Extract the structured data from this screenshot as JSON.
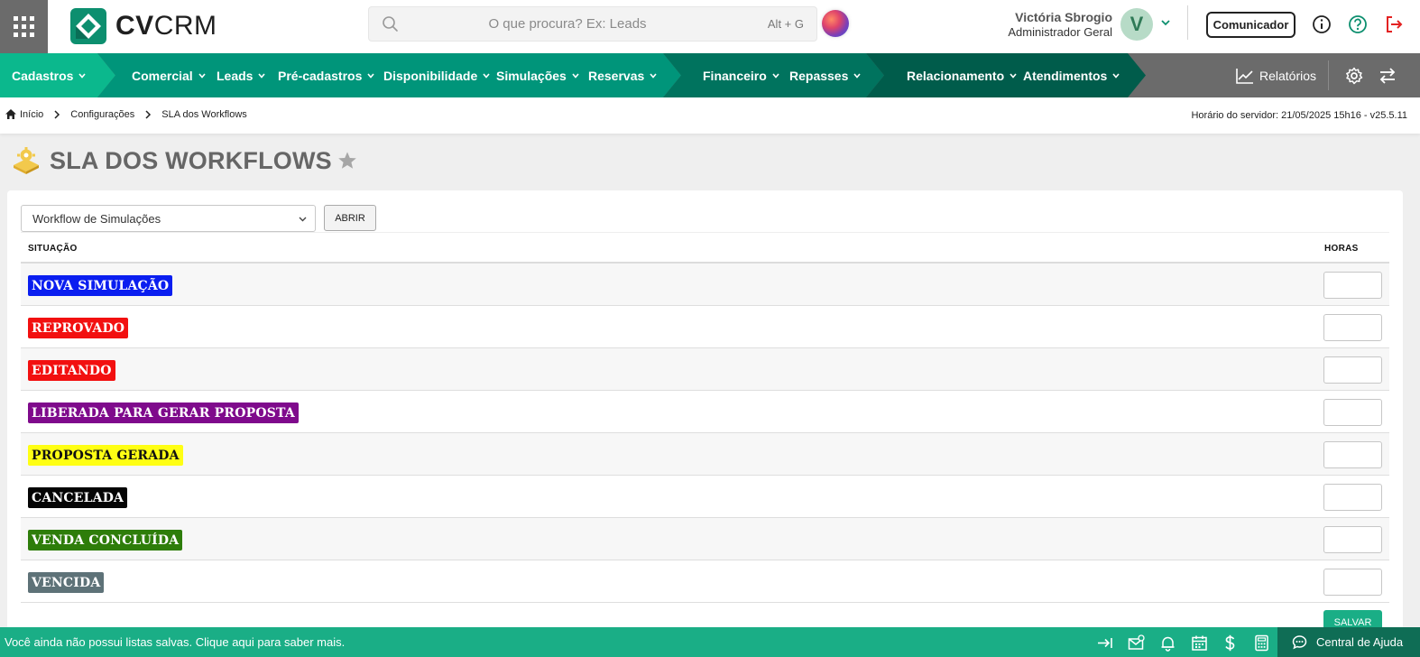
{
  "header": {
    "logo": {
      "brand_bold": "CV",
      "brand_light": "CRM"
    },
    "search": {
      "placeholder": "O que procura? Ex: Leads",
      "shortcut": "Alt + G"
    },
    "user": {
      "name": "Victória Sbrogio",
      "role": "Administrador Geral",
      "initial": "V"
    },
    "comunicador_label": "Comunicador",
    "icons": [
      "apps-grid-icon",
      "search-icon",
      "ai-assistant-icon",
      "chevron-down-icon",
      "info-icon",
      "help-icon",
      "logout-icon"
    ]
  },
  "nav": {
    "items": [
      {
        "label": "Cadastros"
      },
      {
        "label": "Comercial"
      },
      {
        "label": "Leads"
      },
      {
        "label": "Pré-cadastros"
      },
      {
        "label": "Disponibilidade"
      },
      {
        "label": "Simulações"
      },
      {
        "label": "Reservas"
      },
      {
        "label": "Financeiro"
      },
      {
        "label": "Repasses"
      },
      {
        "label": "Relacionamento"
      },
      {
        "label": "Atendimentos"
      }
    ],
    "reports_label": "Relatórios",
    "colors": {
      "seg1": "#0bb88d",
      "seg2": "#00957a",
      "seg3": "#00735e",
      "seg4": "#005c4b",
      "gray": "#6b6b6b"
    }
  },
  "breadcrumb": {
    "items": [
      "Início",
      "Configurações",
      "SLA dos Workflows"
    ],
    "server_time": "Horário do servidor: 21/05/2025 15h16 - v25.5.11"
  },
  "page": {
    "title": "SLA DOS WORKFLOWS",
    "workflow_select": "Workflow de Simulações",
    "open_button": "ABRIR",
    "columns": {
      "situacao": "SITUAÇÃO",
      "horas": "HORAS"
    },
    "statuses": [
      {
        "label": "NOVA SIMULAÇÃO",
        "color": "#0a1ef0",
        "text_color": "#ffffff",
        "hours": ""
      },
      {
        "label": "REPROVADO",
        "color": "#f21010",
        "text_color": "#ffffff",
        "hours": ""
      },
      {
        "label": "EDITANDO",
        "color": "#f21010",
        "text_color": "#ffffff",
        "hours": ""
      },
      {
        "label": "LIBERADA PARA GERAR PROPOSTA",
        "color": "#7f0a8c",
        "text_color": "#ffffff",
        "hours": ""
      },
      {
        "label": "PROPOSTA GERADA",
        "color": "#ffff14",
        "text_color": "#111111",
        "hours": ""
      },
      {
        "label": "CANCELADA",
        "color": "#050505",
        "text_color": "#ffffff",
        "hours": ""
      },
      {
        "label": "VENDA CONCLUÍDA",
        "color": "#2e7d0a",
        "text_color": "#ffffff",
        "hours": ""
      },
      {
        "label": "VENCIDA",
        "color": "#5e7278",
        "text_color": "#ffffff",
        "hours": ""
      }
    ],
    "save_button": "SALVAR"
  },
  "footer": {
    "message": "Você ainda não possui listas salvas. Clique aqui para saber mais.",
    "help_label": "Central de Ajuda",
    "icons": [
      "expand-sidebar-icon",
      "mail-notification-icon",
      "bell-icon",
      "calendar-icon",
      "dollar-icon",
      "calculator-icon",
      "chat-help-icon"
    ]
  }
}
